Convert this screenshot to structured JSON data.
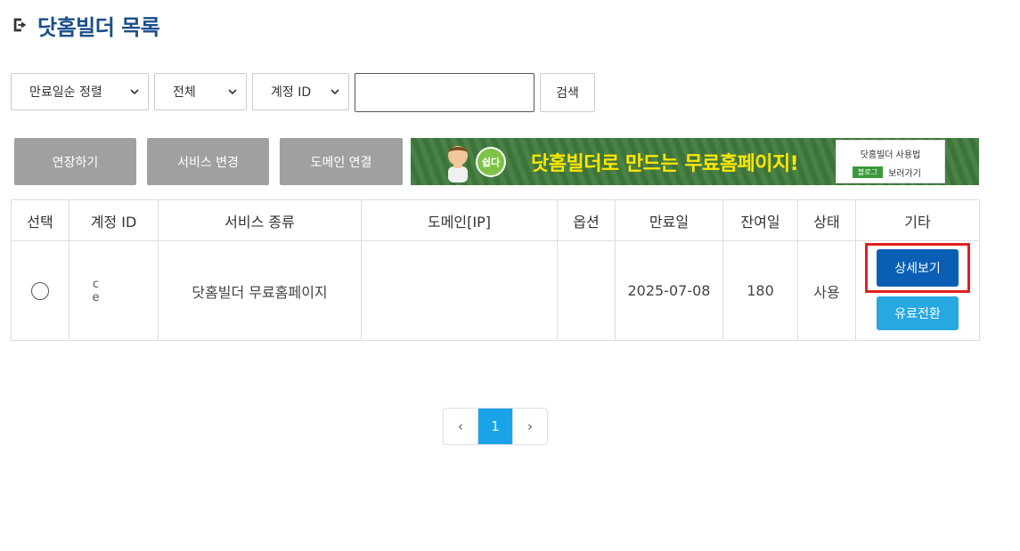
{
  "page": {
    "title": "닷홈빌더 목록",
    "title_icon": "sign-out-icon"
  },
  "filters": {
    "sort_select": "만료일순 정렬",
    "status_select": "전체",
    "field_select": "계정 ID",
    "search_value": "",
    "search_button": "검색"
  },
  "actions": {
    "extend": "연장하기",
    "change_service": "서비스 변경",
    "connect_domain": "도메인 연결"
  },
  "banner": {
    "badge": "쉽다",
    "headline": "닷홈빌더로 만드는 무료홈페이지!",
    "card_title": "닷홈빌더 사용법",
    "card_tag": "블로그",
    "card_link": "보러가기"
  },
  "table": {
    "headers": [
      "선택",
      "계정 ID",
      "서비스 종류",
      "도메인[IP]",
      "옵션",
      "만료일",
      "잔여일",
      "상태",
      "기타"
    ],
    "rows": [
      {
        "account_id": "c   e",
        "service_type": "닷홈빌더 무료홈페이지",
        "domain": "",
        "option": "",
        "expiry": "2025-07-08",
        "remaining": "180",
        "status": "사용",
        "detail_button": "상세보기",
        "paid_button": "유료전환"
      }
    ]
  },
  "pagination": {
    "prev": "‹",
    "current": "1",
    "next": "›"
  },
  "colors": {
    "title": "#1a4e8a",
    "detail_button": "#0a5fb5",
    "paid_button": "#28a8e0",
    "highlight": "#e02020",
    "gray_button": "#a0a0a0",
    "page_active": "#1aa3e8"
  }
}
